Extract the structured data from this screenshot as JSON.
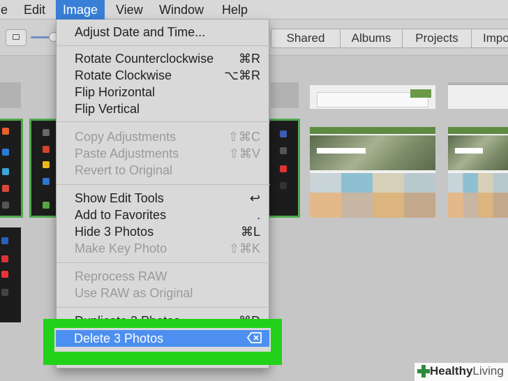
{
  "menubar": {
    "items": [
      "File",
      "Edit",
      "Image",
      "View",
      "Window",
      "Help"
    ]
  },
  "toolbar": {
    "tabs": [
      "Shared",
      "Albums",
      "Projects",
      "Impo"
    ]
  },
  "image_menu": {
    "items": [
      {
        "label": "Adjust Date and Time...",
        "shortcut": ""
      },
      {
        "label": "Rotate Counterclockwise",
        "shortcut": "⌘R"
      },
      {
        "label": "Rotate Clockwise",
        "shortcut": "⌥⌘R"
      },
      {
        "label": "Flip Horizontal",
        "shortcut": ""
      },
      {
        "label": "Flip Vertical",
        "shortcut": ""
      },
      {
        "label": "Copy Adjustments",
        "shortcut": "⇧⌘C"
      },
      {
        "label": "Paste Adjustments",
        "shortcut": "⇧⌘V"
      },
      {
        "label": "Revert to Original",
        "shortcut": ""
      },
      {
        "label": "Show Edit Tools",
        "shortcut": "↩"
      },
      {
        "label": "Add to Favorites",
        "shortcut": "."
      },
      {
        "label": "Hide 3 Photos",
        "shortcut": "⌘L"
      },
      {
        "label": "Make Key Photo",
        "shortcut": "⇧⌘K"
      },
      {
        "label": "Reprocess RAW",
        "shortcut": ""
      },
      {
        "label": "Use RAW as Original",
        "shortcut": ""
      },
      {
        "label": "Duplicate 3 Photos",
        "shortcut": "⌘D"
      },
      {
        "label": "Delete 3 Photos",
        "shortcut": "⌫"
      }
    ]
  },
  "watermark": {
    "brand": "Healthy",
    "brand2": "Living"
  },
  "colors": {
    "highlight": "#4d8ff0",
    "selection_border": "#4ea84e",
    "annotation_box": "#22d21a"
  }
}
